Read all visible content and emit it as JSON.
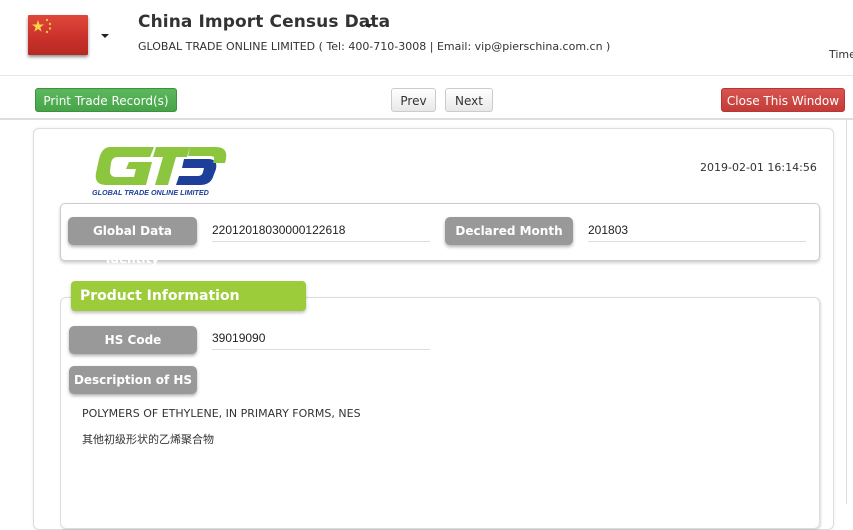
{
  "header": {
    "flag_icon": "china-flag-icon",
    "title": "China Import Census Data",
    "subtitle": "GLOBAL TRADE ONLINE LIMITED ( Tel: 400-710-3008 | Email: vip@pierschina.com.cn )",
    "time_label": "Time"
  },
  "toolbar": {
    "print_label": "Print Trade Record(s)",
    "prev_label": "Prev",
    "next_label": "Next",
    "close_label": "Close This Window"
  },
  "record": {
    "logo_text": "GLOBAL TRADE ONLINE LIMITED",
    "timestamp": "2019-02-01 16:14:56",
    "global_data_identity_label": "Global Data Identity",
    "global_data_identity": "22012018030000122618",
    "declared_month_label": "Declared Month",
    "declared_month": "201803"
  },
  "product": {
    "section_title": "Product Information",
    "hs_code_label": "HS Code",
    "hs_code": "39019090",
    "description_label": "Description of HS",
    "description_en": "POLYMERS OF ETHYLENE, IN PRIMARY FORMS, NES",
    "description_cn": "其他初级形状的乙烯聚合物"
  },
  "colors": {
    "green_button": "#5cb85c",
    "red_button": "#d9534f",
    "section_tab": "#9ccc3a",
    "label_pill": "#999999"
  }
}
